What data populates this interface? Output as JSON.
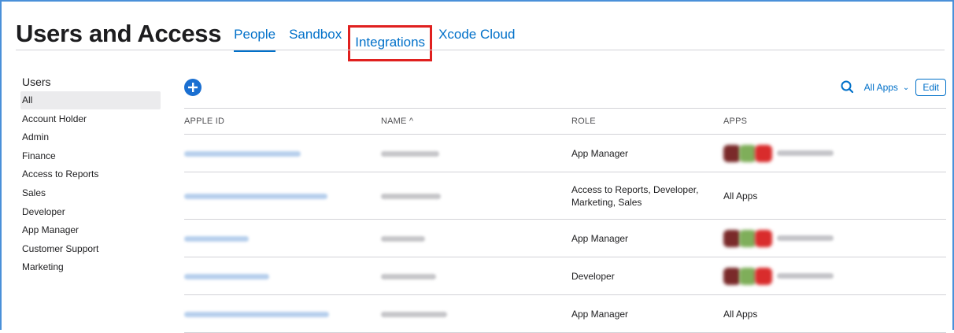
{
  "header": {
    "title": "Users and Access",
    "tabs": [
      {
        "label": "People",
        "active": true
      },
      {
        "label": "Sandbox",
        "active": false
      },
      {
        "label": "Integrations",
        "active": false,
        "highlighted": true
      },
      {
        "label": "Xcode Cloud",
        "active": false
      }
    ]
  },
  "sidebar": {
    "title": "Users",
    "items": [
      {
        "label": "All",
        "selected": true
      },
      {
        "label": "Account Holder"
      },
      {
        "label": "Admin"
      },
      {
        "label": "Finance"
      },
      {
        "label": "Access to Reports"
      },
      {
        "label": "Sales"
      },
      {
        "label": "Developer"
      },
      {
        "label": "App Manager"
      },
      {
        "label": "Customer Support"
      },
      {
        "label": "Marketing"
      }
    ]
  },
  "toolbar": {
    "add_icon": "plus-circle-icon",
    "search_icon": "search-icon",
    "filter_label": "All Apps",
    "filter_chevron": "⌄",
    "edit_label": "Edit"
  },
  "table": {
    "columns": [
      "APPLE ID",
      "NAME ^",
      "ROLE",
      "APPS"
    ],
    "rows": [
      {
        "role": "App Manager",
        "apps": "icons"
      },
      {
        "role": "Access to Reports, Developer, Marketing, Sales",
        "apps": "All Apps"
      },
      {
        "role": "App Manager",
        "apps": "icons"
      },
      {
        "role": "Developer",
        "apps": "icons"
      },
      {
        "role": "App Manager",
        "apps": "All Apps"
      }
    ]
  },
  "colors": {
    "accent": "#0070c9",
    "highlight_box": "#e0201f",
    "selected_bg": "#ebebed"
  }
}
